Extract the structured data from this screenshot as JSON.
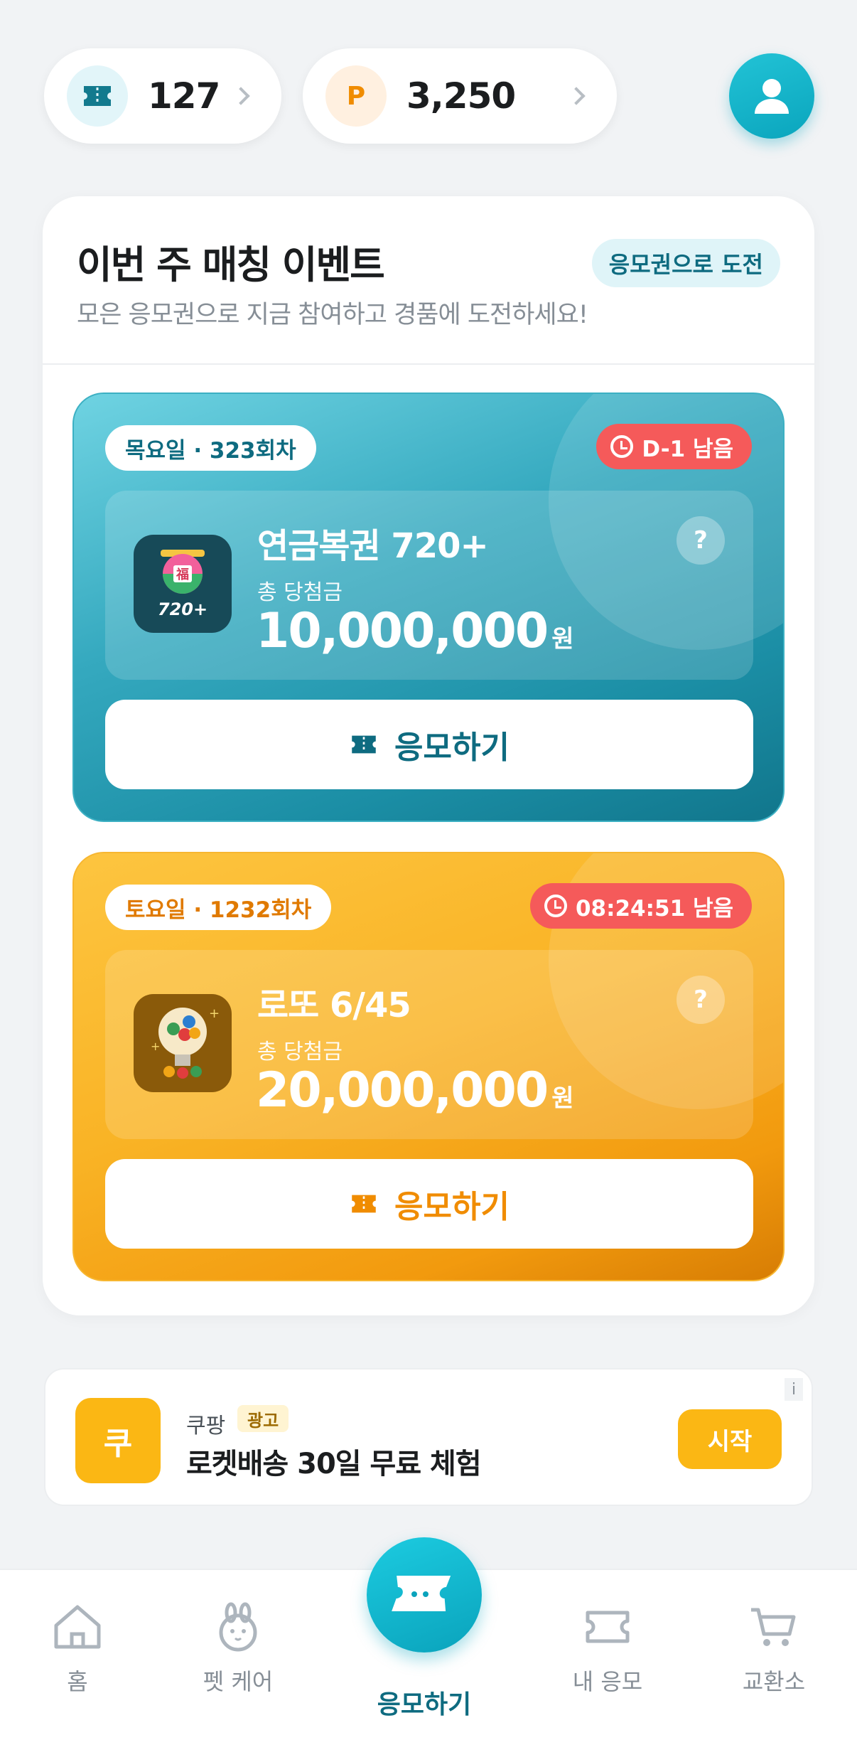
{
  "top": {
    "tickets": "127",
    "points_symbol": "P",
    "points": "3,250"
  },
  "event": {
    "title": "이번 주 매칭 이벤트",
    "badge": "응모권으로 도전",
    "subtitle": "모은 응모권으로 지금 참여하고 경품에 도전하세요!"
  },
  "lotteries": [
    {
      "day": "목요일 · 323회차",
      "remaining": "D-1 남음",
      "name": "연금복권 720+",
      "prize_label": "총 당첨금",
      "prize": "10,000,000",
      "unit": "원",
      "logo_text": "720+",
      "logo_char": "福",
      "help": "?",
      "apply": "응모하기"
    },
    {
      "day": "토요일 · 1232회차",
      "remaining": "08:24:51 남음",
      "name": "로또 6/45",
      "prize_label": "총 당첨금",
      "prize": "20,000,000",
      "unit": "원",
      "help": "?",
      "apply": "응모하기"
    }
  ],
  "ad": {
    "logo": "쿠",
    "brand": "쿠팡",
    "tag": "광고",
    "text": "로켓배송 30일 무료 체험",
    "button": "시작",
    "info": "i"
  },
  "nav": {
    "home": "홈",
    "pet": "펫 케어",
    "apply": "응모하기",
    "my": "내 응모",
    "exchange": "교환소"
  },
  "colors": {
    "accent": "#0aa5bd",
    "teal_text": "#0e6b80",
    "orange": "#f08c00",
    "red_badge": "#f55a5a",
    "ad_yellow": "#fbb714"
  }
}
